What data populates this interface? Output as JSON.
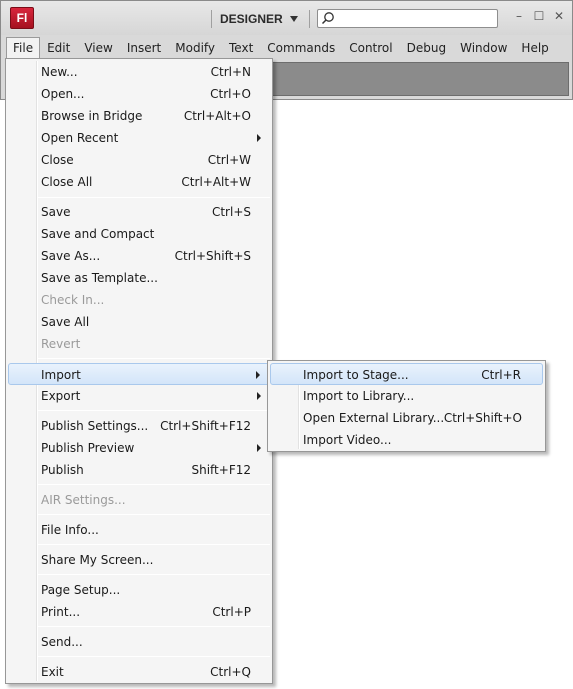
{
  "app": {
    "logo_text": "Fl",
    "brand_color": "#c8192e",
    "workspace": "DESIGNER",
    "search_placeholder": ""
  },
  "window_controls": {
    "minimize": "–",
    "maximize": "☐",
    "close": "✕"
  },
  "menubar": [
    "File",
    "Edit",
    "View",
    "Insert",
    "Modify",
    "Text",
    "Commands",
    "Control",
    "Debug",
    "Window",
    "Help"
  ],
  "file_menu": {
    "items": [
      {
        "label": "New...",
        "shortcut": "Ctrl+N"
      },
      {
        "label": "Open...",
        "shortcut": "Ctrl+O"
      },
      {
        "label": "Browse in Bridge",
        "shortcut": "Ctrl+Alt+O"
      },
      {
        "label": "Open Recent",
        "shortcut": "",
        "submenu": true
      },
      {
        "label": "Close",
        "shortcut": "Ctrl+W"
      },
      {
        "label": "Close All",
        "shortcut": "Ctrl+Alt+W"
      },
      {
        "label": "Save",
        "shortcut": "Ctrl+S"
      },
      {
        "label": "Save and Compact",
        "shortcut": ""
      },
      {
        "label": "Save As...",
        "shortcut": "Ctrl+Shift+S"
      },
      {
        "label": "Save as Template...",
        "shortcut": ""
      },
      {
        "label": "Check In...",
        "shortcut": "",
        "disabled": true
      },
      {
        "label": "Save All",
        "shortcut": ""
      },
      {
        "label": "Revert",
        "shortcut": "",
        "disabled": true
      },
      {
        "label": "Import",
        "shortcut": "",
        "submenu": true,
        "highlighted": true
      },
      {
        "label": "Export",
        "shortcut": "",
        "submenu": true
      },
      {
        "label": "Publish Settings...",
        "shortcut": "Ctrl+Shift+F12"
      },
      {
        "label": "Publish Preview",
        "shortcut": "",
        "submenu": true
      },
      {
        "label": "Publish",
        "shortcut": "Shift+F12"
      },
      {
        "label": "AIR Settings...",
        "shortcut": "",
        "disabled": true
      },
      {
        "label": "File Info...",
        "shortcut": ""
      },
      {
        "label": "Share My Screen...",
        "shortcut": ""
      },
      {
        "label": "Page Setup...",
        "shortcut": ""
      },
      {
        "label": "Print...",
        "shortcut": "Ctrl+P"
      },
      {
        "label": "Send...",
        "shortcut": ""
      },
      {
        "label": "Exit",
        "shortcut": "Ctrl+Q"
      }
    ]
  },
  "import_submenu": {
    "items": [
      {
        "label": "Import to Stage...",
        "shortcut": "Ctrl+R",
        "highlighted": true
      },
      {
        "label": "Import to Library...",
        "shortcut": ""
      },
      {
        "label": "Open External Library...",
        "shortcut": "Ctrl+Shift+O"
      },
      {
        "label": "Import Video...",
        "shortcut": ""
      }
    ]
  }
}
